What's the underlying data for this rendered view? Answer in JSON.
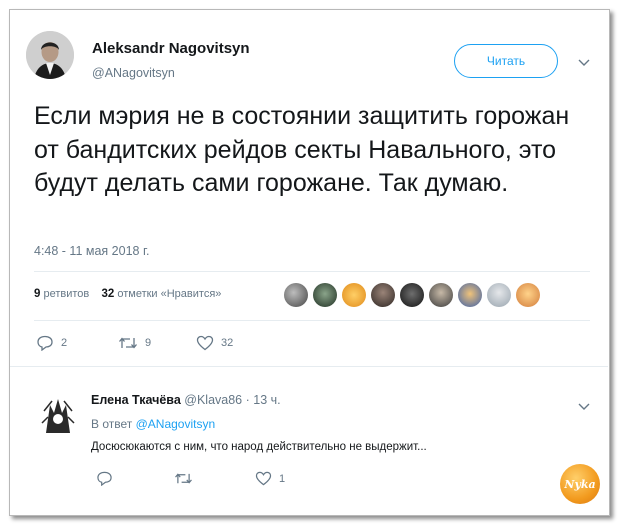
{
  "tweet": {
    "author_name": "Aleksandr Nagovitsyn",
    "author_handle": "@ANagovitsyn",
    "follow_label": "Читать",
    "text": "Если мэрия не в состоянии защитить горожан от бандитских рейдов секты Навального, это будут делать сами горожане. Так думаю.",
    "timestamp": "4:48 - 11 мая 2018 г.",
    "retweets_count": "9",
    "retweets_label": "ретвитов",
    "likes_count": "32",
    "likes_label": "отметки «Нравится»",
    "actions": {
      "reply_count": "2",
      "retweet_count": "9",
      "like_count": "32"
    }
  },
  "reply": {
    "author_name": "Елена Ткачёва",
    "author_handle": "@Klava86",
    "time": "· 13 ч.",
    "in_reply_label": "В ответ",
    "in_reply_handle": "@ANagovitsyn",
    "text": "Досюсюкаются с ним, что народ действительно не выдержит...",
    "actions": {
      "reply_count": "",
      "retweet_count": "",
      "like_count": "1"
    }
  },
  "watermark_text": "Nyka",
  "icons": [
    "chevron-down-icon",
    "reply-icon",
    "retweet-icon",
    "heart-icon"
  ],
  "colors": {
    "accent": "#1da1f2",
    "text": "#14171a",
    "muted": "#657786",
    "divider": "#e6ecf0"
  }
}
